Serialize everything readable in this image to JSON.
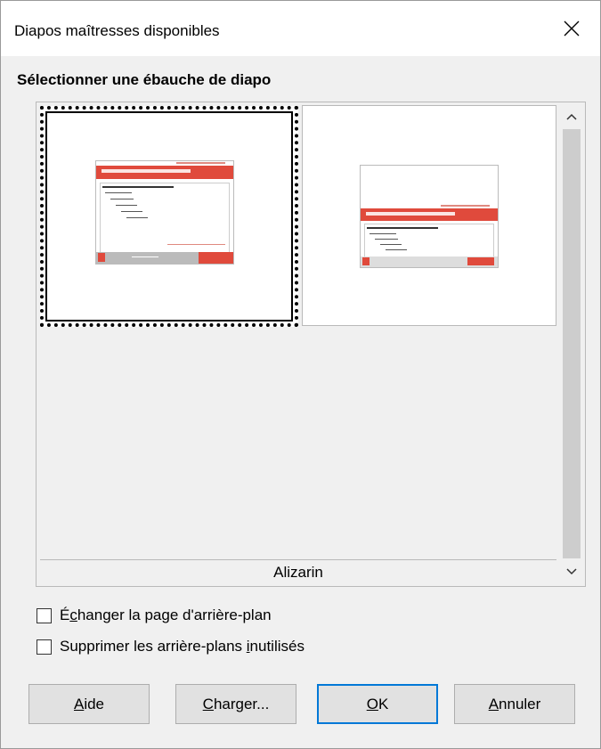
{
  "window": {
    "title": "Diapos maîtresses disponibles",
    "close_icon": "close-icon"
  },
  "section": {
    "label": "Sélectionner une ébauche de diapo"
  },
  "thumbnails": {
    "items": [
      {
        "slide_title": "Diapos pour éditer Informatique Libre"
      },
      {
        "slide_title": "Diapos pour éditer Informatique Libre"
      }
    ],
    "selected_name": "Alizarin"
  },
  "options": {
    "exchange": {
      "label_pre": "É",
      "label_u": "c",
      "label_post": "hanger la page d'arrière-plan"
    },
    "delete": {
      "label_pre": "Supprimer les arrière-plans ",
      "label_u": "i",
      "label_post": "nutilisés"
    }
  },
  "buttons": {
    "help": {
      "u": "A",
      "rest": "ide"
    },
    "load": {
      "u": "C",
      "rest": "harger..."
    },
    "ok": {
      "u": "O",
      "rest": "K"
    },
    "cancel": {
      "u": "A",
      "rest": "nnuler"
    }
  },
  "colors": {
    "accent": "#0078d7",
    "slide_red": "#e04a3c"
  }
}
